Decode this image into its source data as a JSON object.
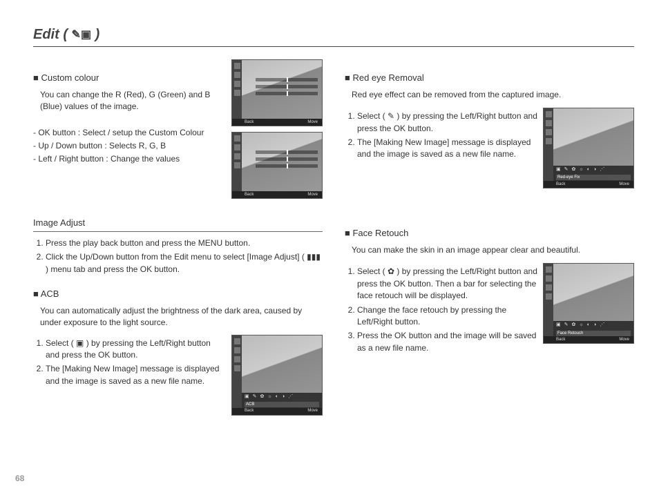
{
  "page": {
    "title": "Edit ( ",
    "title_end": " )",
    "number": "68"
  },
  "custom_colour": {
    "heading": "■ Custom colour",
    "desc": "You can change the R (Red), G (Green) and B (Blue) values of the image.",
    "lines": [
      "- OK button : Select / setup the Custom Colour",
      "- Up / Down button  : Selects R, G, B",
      "- Left / Right button  : Change the values"
    ]
  },
  "image_adjust": {
    "heading": "Image Adjust",
    "steps": [
      "Press the play back button and press the MENU button.",
      "Click the Up/Down button from the Edit menu to select [Image Adjust] ( ▮▮▮ ) menu tab and press the OK button."
    ]
  },
  "acb": {
    "heading": "■ ACB",
    "desc": "You can automatically adjust the brightness of the dark area, caused by under exposure to the light source.",
    "steps": [
      "Select ( ▣ ) by pressing the Left/Right button and press the OK button.",
      "The [Making New Image] message is displayed and the image is saved as a new file name."
    ],
    "overlay_label": "ACB"
  },
  "redeye": {
    "heading": "■ Red eye Removal",
    "desc": "Red eye effect can be removed from the captured image.",
    "steps": [
      "Select ( ✎ ) by pressing the Left/Right button and press the OK button.",
      "The [Making New Image] message is displayed and the image is saved as a new file name."
    ],
    "overlay_label": "Red-eye Fix"
  },
  "face_retouch": {
    "heading": "■ Face Retouch",
    "desc": "You can make the skin in an image appear clear and beautiful.",
    "steps": [
      "Select ( ✿ ) by pressing the Left/Right button and press the OK button. Then a bar for selecting the face retouch will be displayed.",
      "Change the face retouch by pressing the Left/Right button.",
      "Press the OK button and the image will be saved as a new file name."
    ],
    "overlay_label": "Face Retouch"
  },
  "thumb_footer": {
    "back": "Back",
    "move": "Move"
  }
}
